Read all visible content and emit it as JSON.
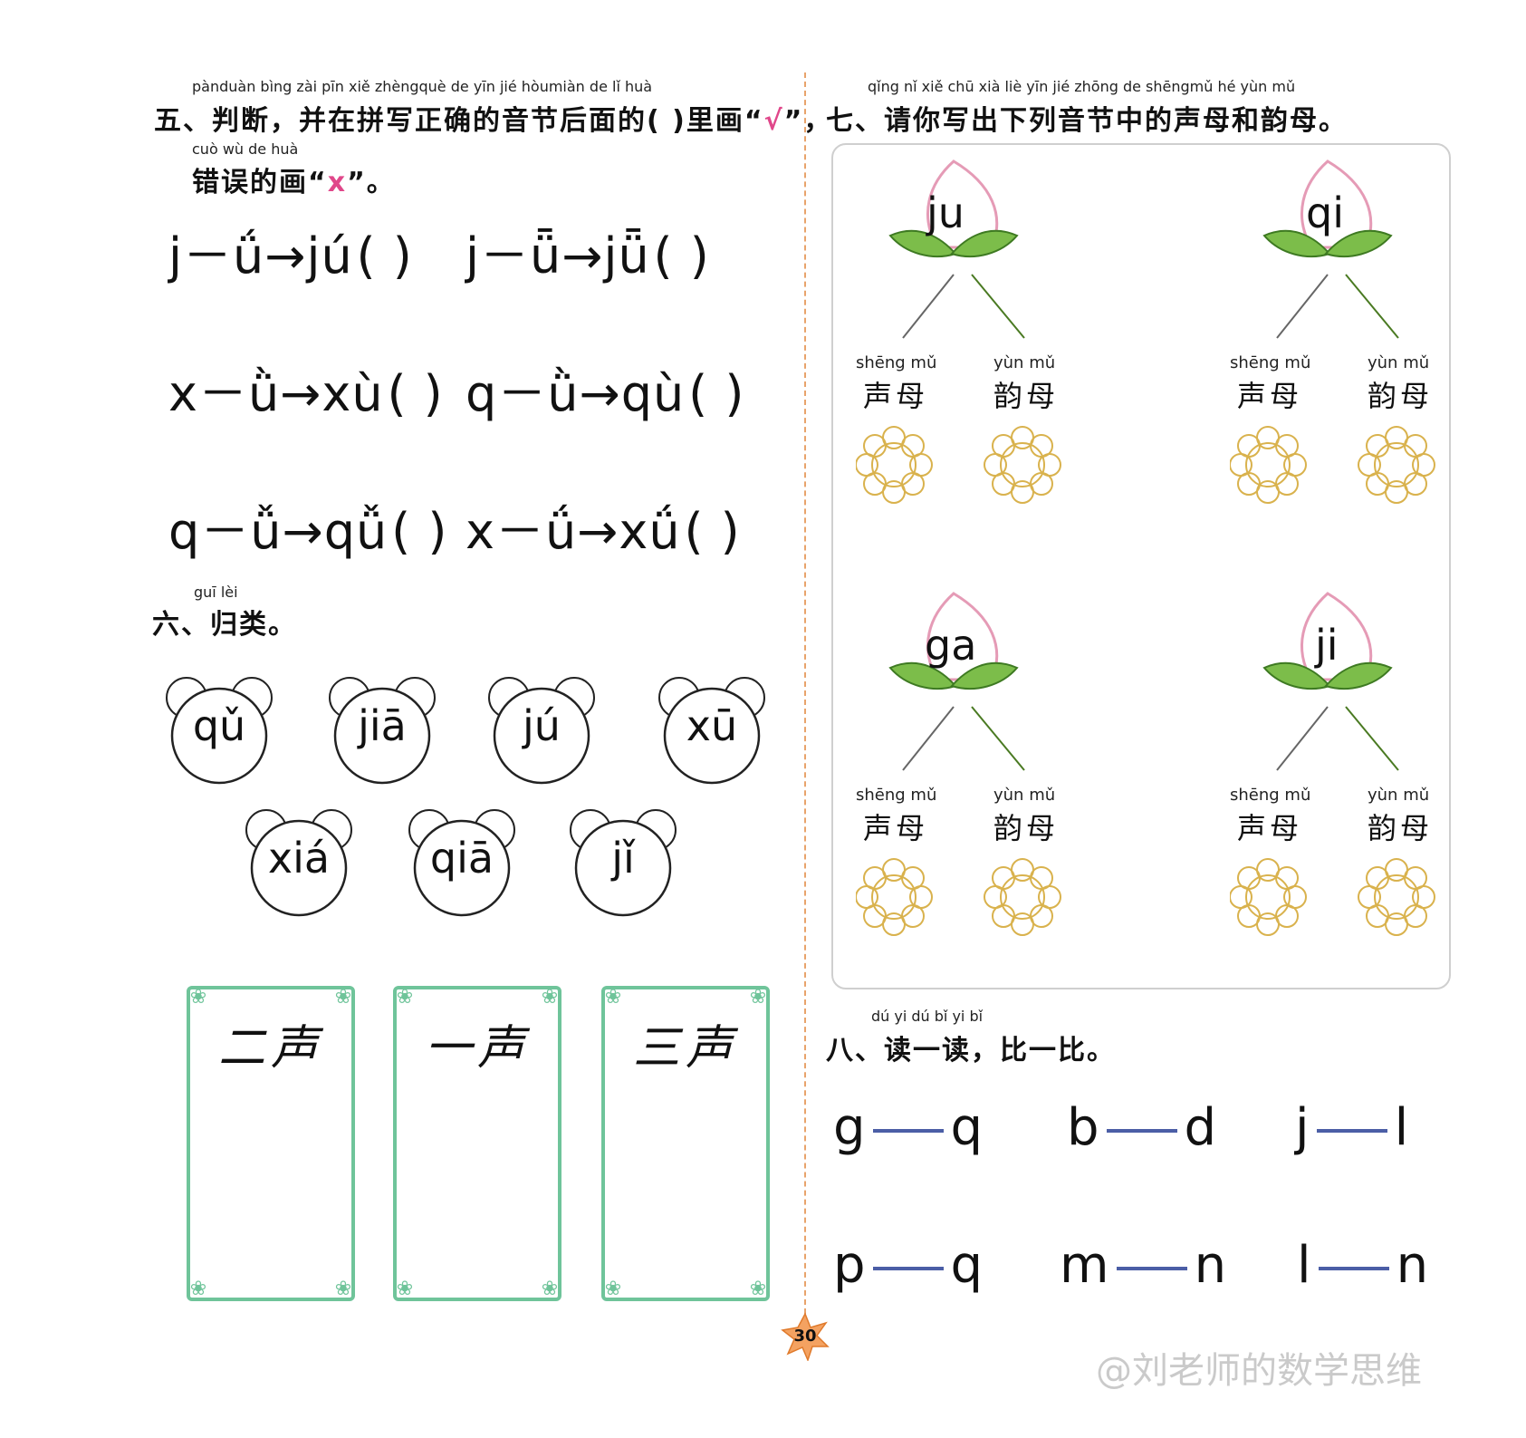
{
  "section5": {
    "pinyin_line1": "pànduàn  bìng zài  pīn  xiě zhèngquè  de   yīn   jié  hòumiàn de                    lǐ  huà",
    "title_line1_a": "五、判断，并在拼写正确的音节后面的(     )里画“",
    "check_mark": "√",
    "title_line1_b": "”，",
    "pinyin_line2": "cuò  wù   de  huà",
    "title_line2_a": "错误的画“",
    "cross_mark": "x",
    "title_line2_b": "”。",
    "rows": [
      [
        "j－ǘ→jú",
        "j－ǖ→jǖ"
      ],
      [
        "x－ǜ→xù",
        "q－ǜ→qù"
      ],
      [
        "q－ǚ→qǚ",
        "x－ǘ→xǘ"
      ]
    ],
    "paren": "(    )"
  },
  "section6": {
    "pinyin": "guī  lèi",
    "title": "六、归类。",
    "bears_row1": [
      "qǔ",
      "jiā",
      "jú",
      "xū"
    ],
    "bears_row2": [
      "xiá",
      "qiā",
      "jǐ"
    ],
    "boxes": [
      "二声",
      "一声",
      "三声"
    ]
  },
  "section7": {
    "pinyin": "qǐng  nǐ   xiě  chū  xià   liè   yīn   jié zhōng de shēngmǔ  hé  yùn  mǔ",
    "title": "七、请你写出下列音节中的声母和韵母。",
    "syllables": [
      "ju",
      "qi",
      "ga",
      "ji"
    ],
    "left_label_pinyin": "shēng mǔ",
    "left_label": "声母",
    "right_label_pinyin": "yùn  mǔ",
    "right_label": "韵母"
  },
  "section8": {
    "pinyin": "dú   yi   dú       bǐ   yi   bǐ",
    "title": "八、读一读，比一比。",
    "pairs": [
      [
        "g",
        "q"
      ],
      [
        "b",
        "d"
      ],
      [
        "j",
        "l"
      ],
      [
        "p",
        "q"
      ],
      [
        "m",
        "n"
      ],
      [
        "l",
        "n"
      ]
    ]
  },
  "page_number": "30",
  "watermark": "@刘老师的数学思维",
  "colors": {
    "accent_pink": "#e0478a",
    "frame_green": "#6fc49a",
    "divider_orange": "#e8a36b",
    "dash_blue": "#4b5ea6"
  }
}
